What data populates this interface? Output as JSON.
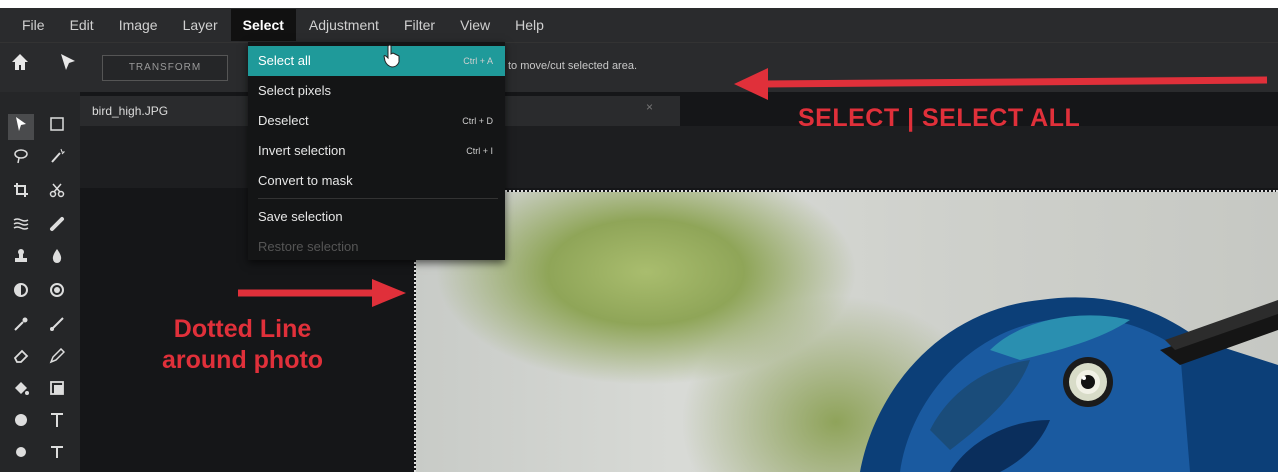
{
  "menubar": {
    "items": [
      "File",
      "Edit",
      "Image",
      "Layer",
      "Select",
      "Adjustment",
      "Filter",
      "View",
      "Help"
    ],
    "active": "Select"
  },
  "toolbar": {
    "transform_label": "TRANSFORM",
    "hint_text": "to move/cut selected area."
  },
  "document": {
    "tab_label": "bird_high.JPG",
    "close_glyph": "×"
  },
  "select_menu": {
    "items": [
      {
        "label": "Select all",
        "shortcut": "Ctrl + A",
        "state": "highlighted"
      },
      {
        "label": "Select pixels",
        "shortcut": "",
        "state": "normal"
      },
      {
        "label": "Deselect",
        "shortcut": "Ctrl + D",
        "state": "normal"
      },
      {
        "label": "Invert selection",
        "shortcut": "Ctrl + I",
        "state": "normal"
      },
      {
        "label": "Convert to mask",
        "shortcut": "",
        "state": "normal"
      },
      {
        "label": "Save selection",
        "shortcut": "",
        "state": "normal"
      },
      {
        "label": "Restore selection",
        "shortcut": "",
        "state": "disabled"
      }
    ]
  },
  "annotations": {
    "top_label": "SELECT | SELECT ALL",
    "left_label_line1": "Dotted Line",
    "left_label_line2": "around photo",
    "color": "#e0303a"
  },
  "colors": {
    "highlight": "#1f9a9a",
    "menu_bg": "#141516",
    "app_bg": "#1e1f21"
  }
}
